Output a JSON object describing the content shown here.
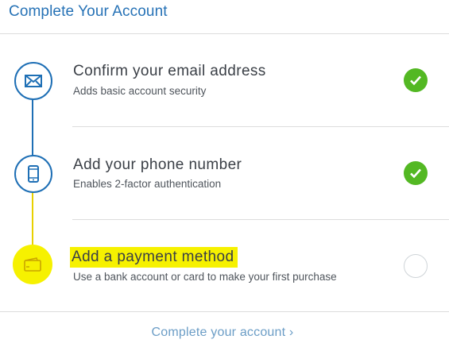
{
  "header": {
    "title": "Complete Your Account"
  },
  "steps": [
    {
      "title": "Confirm your email address",
      "subtitle": "Adds basic account security",
      "status": "complete",
      "icon": "envelope-icon"
    },
    {
      "title": "Add your phone number",
      "subtitle": "Enables 2-factor authentication",
      "status": "complete",
      "icon": "phone-icon"
    },
    {
      "title": "Add a payment method",
      "subtitle": "Use a bank account or card to make your first purchase",
      "status": "pending",
      "icon": "wallet-icon"
    }
  ],
  "footer": {
    "link_label": "Complete your account ›"
  },
  "colors": {
    "accent": "#1e6fb5",
    "success": "#53b823",
    "highlight": "#f6f100",
    "link": "#6b9dc6"
  }
}
